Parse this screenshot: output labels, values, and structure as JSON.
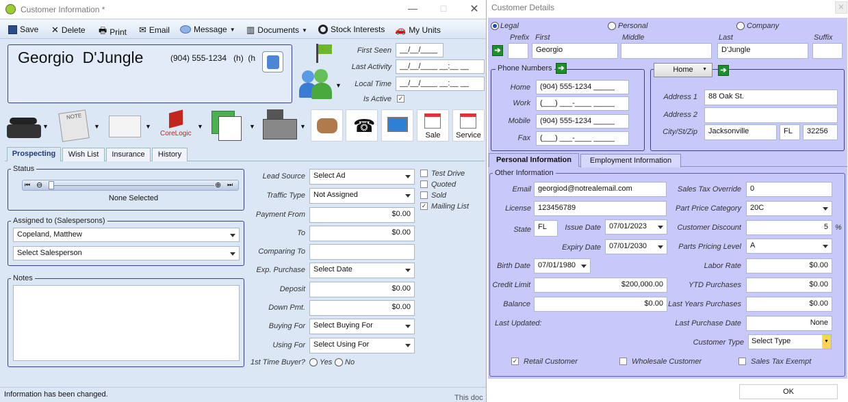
{
  "left": {
    "title": "Customer Information *",
    "toolbar": {
      "save": "Save",
      "delete": "Delete",
      "print": "Print",
      "email": "Email",
      "message": "Message",
      "documents": "Documents",
      "stock": "Stock Interests",
      "units": "My Units"
    },
    "header": {
      "name": "Georgio  D'Jungle",
      "phone": "(904) 555-1234   (h)  (h",
      "first_seen_label": "First Seen",
      "first_seen": "__/__/____",
      "last_activity_label": "Last Activity",
      "last_activity": "__/__/____ __:__ __",
      "local_time_label": "Local Time",
      "local_time": "__/__/____ __:__ __",
      "is_active_label": "Is Active"
    },
    "corelogic": "CoreLogic",
    "sale": "Sale",
    "service": "Service",
    "tabs": [
      "Prospecting",
      "Wish List",
      "Insurance",
      "History"
    ],
    "status": {
      "title": "Status",
      "value": "None Selected"
    },
    "assigned": {
      "title": "Assigned to (Salespersons)",
      "first": "Copeland, Matthew",
      "second": "Select Salesperson"
    },
    "notes": {
      "title": "Notes"
    },
    "fields": {
      "lead_source_label": "Lead Source",
      "lead_source": "Select Ad",
      "traffic_type_label": "Traffic Type",
      "traffic_type": "Not Assigned",
      "payment_from_label": "Payment From",
      "payment_from": "$0.00",
      "to_label": "To",
      "to": "$0.00",
      "comparing_to_label": "Comparing To",
      "exp_purchase_label": "Exp. Purchase",
      "exp_purchase": "Select Date",
      "deposit_label": "Deposit",
      "deposit": "$0.00",
      "down_pmt_label": "Down Pmt.",
      "down_pmt": "$0.00",
      "buying_for_label": "Buying For",
      "buying_for": "Select Buying For",
      "using_for_label": "Using For",
      "using_for": "Select Using For",
      "first_time_label": "1st Time Buyer?",
      "yes": "Yes",
      "no": "No"
    },
    "checks": {
      "test_drive": "Test Drive",
      "quoted": "Quoted",
      "sold": "Sold",
      "mailing_list": "Mailing List"
    },
    "status_bar": "Information has been changed.",
    "background_text": "This doc"
  },
  "right": {
    "title": "Customer Details",
    "types": {
      "legal": "Legal",
      "personal": "Personal",
      "company": "Company"
    },
    "name_labels": {
      "prefix": "Prefix",
      "first": "First",
      "middle": "Middle",
      "last": "Last",
      "suffix": "Suffix"
    },
    "name": {
      "prefix": "",
      "first": "Georgio",
      "middle": "",
      "last": "D'Jungle",
      "suffix": ""
    },
    "phones": {
      "title": "Phone Numbers",
      "home_label": "Home",
      "home": "(904) 555-1234 _____",
      "work_label": "Work",
      "work": "(___) ___-____ _____",
      "mobile_label": "Mobile",
      "mobile": "(904) 555-1234 _____",
      "fax_label": "Fax",
      "fax": "(___) ___-____ _____"
    },
    "address": {
      "type": "Home",
      "addr1_label": "Address 1",
      "addr1": "88 Oak St.",
      "addr2_label": "Address 2",
      "addr2": "",
      "csz_label": "City/St/Zip",
      "city": "Jacksonville",
      "state": "FL",
      "zip": "32256"
    },
    "tabs": [
      "Personal Information",
      "Employment Information"
    ],
    "other": {
      "title": "Other Information",
      "email_label": "Email",
      "email": "georgiod@notrealemail.com",
      "license_label": "License",
      "license": "123456789",
      "state_label": "State",
      "state": "FL",
      "issue_label": "Issue Date",
      "issue": "07/01/2023",
      "expiry_label": "Expiry Date",
      "expiry": "07/01/2030",
      "birth_label": "Birth Date",
      "birth": "07/01/1980",
      "credit_label": "Credit Limit",
      "credit": "$200,000.00",
      "balance_label": "Balance",
      "balance": "$0.00",
      "updated_label": "Last Updated:",
      "tax_override_label": "Sales Tax Override",
      "tax_override": "0",
      "ppc_label": "Part Price Category",
      "ppc": "20C",
      "discount_label": "Customer Discount",
      "discount": "5",
      "pct": "%",
      "ppl_label": "Parts Pricing Level",
      "ppl": "A",
      "labor_label": "Labor Rate",
      "labor": "$0.00",
      "ytd_label": "YTD Purchases",
      "ytd": "$0.00",
      "lyp_label": "Last Years Purchases",
      "lyp": "$0.00",
      "lpd_label": "Last Purchase Date",
      "lpd": "None",
      "ctype_label": "Customer Type",
      "ctype": "Select Type",
      "retail": "Retail Customer",
      "wholesale": "Wholesale Customer",
      "exempt": "Sales Tax Exempt"
    },
    "ok": "OK"
  }
}
